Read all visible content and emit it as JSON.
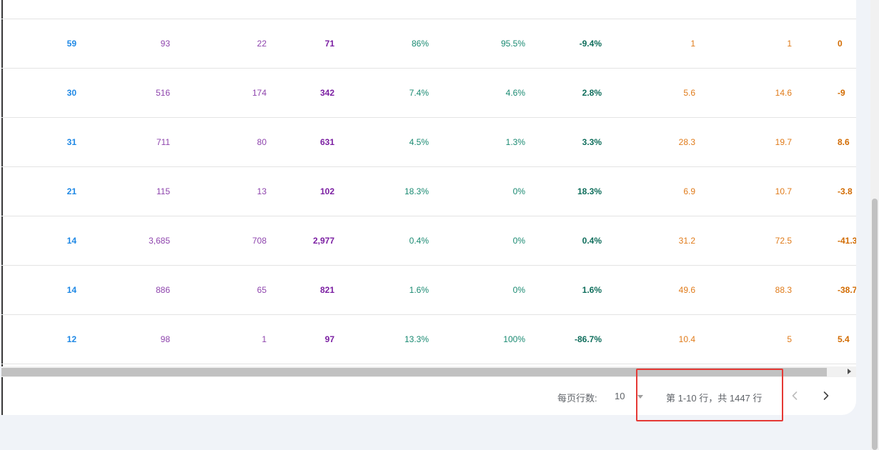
{
  "table": {
    "rows": [
      [
        "59",
        "93",
        "22",
        "71",
        "86%",
        "95.5%",
        "-9.4%",
        "1",
        "1",
        "0"
      ],
      [
        "30",
        "516",
        "174",
        "342",
        "7.4%",
        "4.6%",
        "2.8%",
        "5.6",
        "14.6",
        "-9"
      ],
      [
        "31",
        "711",
        "80",
        "631",
        "4.5%",
        "1.3%",
        "3.3%",
        "28.3",
        "19.7",
        "8.6"
      ],
      [
        "21",
        "115",
        "13",
        "102",
        "18.3%",
        "0%",
        "18.3%",
        "6.9",
        "10.7",
        "-3.8"
      ],
      [
        "14",
        "3,685",
        "708",
        "2,977",
        "0.4%",
        "0%",
        "0.4%",
        "31.2",
        "72.5",
        "-41.3"
      ],
      [
        "14",
        "886",
        "65",
        "821",
        "1.6%",
        "0%",
        "1.6%",
        "49.6",
        "88.3",
        "-38.7"
      ],
      [
        "12",
        "98",
        "1",
        "97",
        "13.3%",
        "100%",
        "-86.7%",
        "10.4",
        "5",
        "5.4"
      ]
    ]
  },
  "pagination": {
    "rows_per_page_label": "每页行数:",
    "rows_per_page_value": "10",
    "range_text": "第 1-10 行，共 1447 行",
    "prev_icon": "chevron-left-icon",
    "next_icon": "chevron-right-icon"
  },
  "colors": {
    "count_blue": "#1e88e5",
    "purple": "#8e44ad",
    "teal": "#1a8a72",
    "orange": "#e07b1a",
    "highlight_red": "#e53935"
  }
}
